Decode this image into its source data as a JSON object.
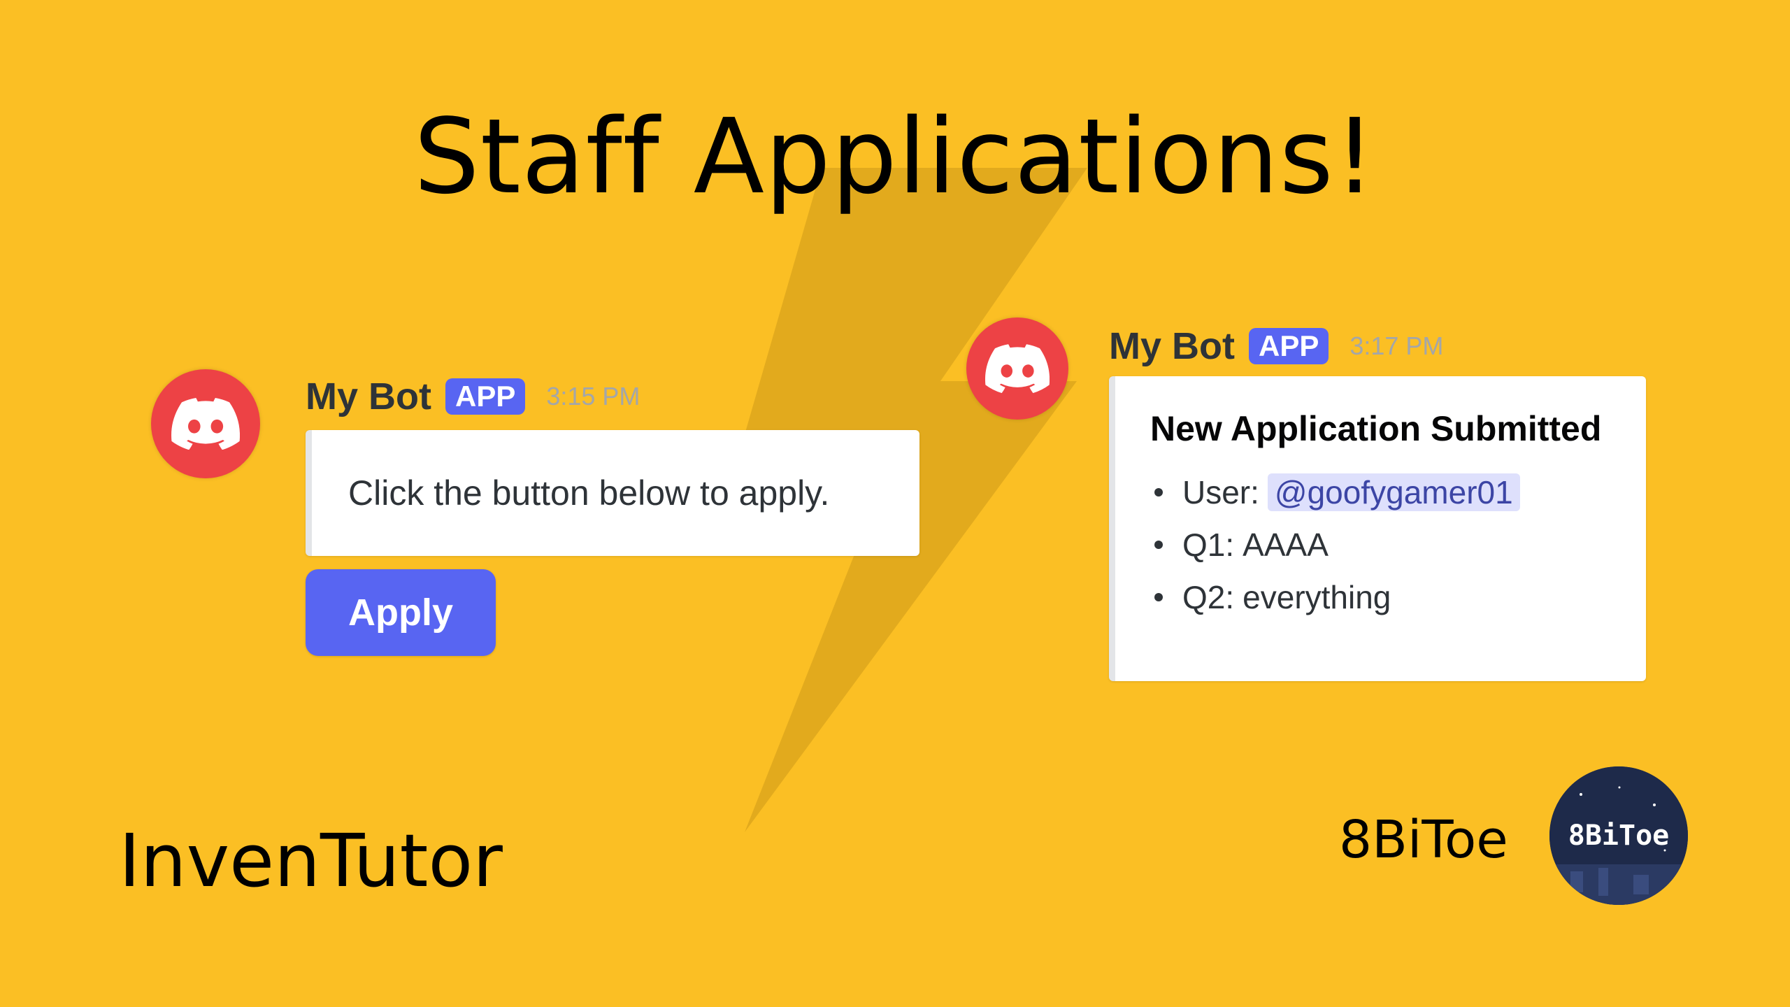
{
  "title": "Staff Applications!",
  "left_message": {
    "bot_name": "My Bot",
    "badge": "APP",
    "time": "3:15 PM",
    "embed_text": "Click the button below to apply.",
    "button_label": "Apply"
  },
  "right_message": {
    "bot_name": "My Bot",
    "badge": "APP",
    "time": "3:17 PM",
    "embed_title": "New Application Submitted",
    "items": [
      {
        "label": "User:",
        "value": "@goofygamer01",
        "mention": true
      },
      {
        "label": "Q1:",
        "value": "AAAA",
        "mention": false
      },
      {
        "label": "Q2:",
        "value": "everything",
        "mention": false
      }
    ]
  },
  "footer": {
    "left_text": "InvenTutor",
    "right_text": "8BiToe",
    "logo_text": "8BiToe"
  },
  "colors": {
    "background": "#FBBF24",
    "blurple": "#5865F2",
    "discord_red": "#ED4245"
  },
  "icons": {
    "avatar": "discord-logo-icon"
  }
}
